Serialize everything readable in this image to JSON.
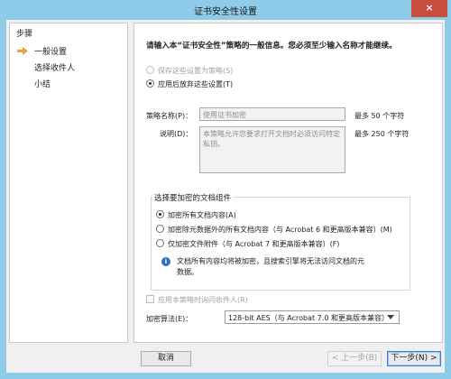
{
  "window": {
    "title": "证书安全性设置",
    "close_glyph": "×"
  },
  "steps": {
    "heading": "步骤",
    "items": [
      {
        "label": "一般设置",
        "current": true
      },
      {
        "label": "选择收件人",
        "current": false
      },
      {
        "label": "小结",
        "current": false
      }
    ]
  },
  "main": {
    "heading": "请输入本“证书安全性”策略的一般信息。您必须至少输入名称才能继续。",
    "save_policy_label": "保存这些设置为策略(S)",
    "discard_label": "应用后放弃这些设置(T)",
    "policy_name_label": "策略名称(P)：",
    "policy_name_value": "使用证书加密",
    "policy_name_hint": "最多 50 个字符",
    "description_label": "说明(D)：",
    "description_value": "本策略允许您要求打开文档时必须访问特定私钥。",
    "description_hint": "最多 250 个字符",
    "encrypt_group": {
      "title": "选择要加密的文档组件",
      "options": [
        {
          "label": "加密所有文档内容(A)",
          "checked": true
        },
        {
          "label": "加密除元数据外的所有文档内容（与 Acrobat 6 和更高版本兼容）(M)",
          "checked": false
        },
        {
          "label": "仅加密文件附件（与 Acrobat 7 和更高版本兼容）(F)",
          "checked": false
        }
      ],
      "info_icon_glyph": "i",
      "info_line1": "文档所有内容均将被加密，且搜索引擎将无法访问文档的元",
      "info_line2": "数据。"
    },
    "ask_recipients_label": "应用本策略时询问收件人(R)",
    "algorithm_label": "加密算法(E)：",
    "algorithm_value": "128-bit AES（与 Acrobat 7.0 和更高版本兼容）"
  },
  "buttons": {
    "cancel": "取消",
    "back": "< 上一步(B)",
    "next": "下一步(N) >"
  },
  "colors": {
    "titlebar": "#8ecbe8",
    "close_button": "#c74d3f",
    "info_icon": "#2d6fc5",
    "step_arrow": "#e8a13a"
  },
  "icons": {
    "current_step": "arrow-right-icon",
    "close": "close-icon",
    "info": "info-icon",
    "dropdown": "chevron-down-icon"
  }
}
